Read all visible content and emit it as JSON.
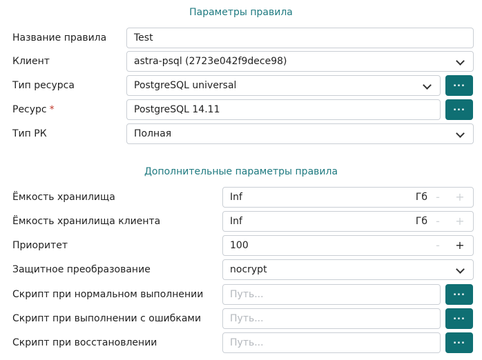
{
  "sections": {
    "main_title": "Параметры правила",
    "extra_title": "Дополнительные параметры правила"
  },
  "fields": {
    "rule_name": {
      "label": "Название правила",
      "value": "Test"
    },
    "client": {
      "label": "Клиент",
      "value": "astra-psql (2723e042f9dece98)"
    },
    "resource_type": {
      "label": "Тип ресурса",
      "value": "PostgreSQL universal",
      "button": "..."
    },
    "resource": {
      "label": "Ресурс",
      "required_mark": "*",
      "value": "PostgreSQL 14.11",
      "button": "..."
    },
    "backup_type": {
      "label": "Тип РК",
      "value": "Полная"
    },
    "storage_capacity": {
      "label": "Ёмкость хранилища",
      "value": "Inf",
      "unit": "Гб",
      "minus": "-",
      "plus": "+"
    },
    "client_storage_capacity": {
      "label": "Ёмкость хранилища клиента",
      "value": "Inf",
      "unit": "Гб",
      "minus": "-",
      "plus": "+"
    },
    "priority": {
      "label": "Приоритет",
      "value": "100",
      "minus": "-",
      "plus": "+"
    },
    "protective_transform": {
      "label": "Защитное преобразование",
      "value": "nocrypt"
    },
    "script_normal": {
      "label": "Скрипт при нормальном выполнении",
      "placeholder": "Путь...",
      "button": "..."
    },
    "script_errors": {
      "label": "Скрипт при выполнении с ошибками",
      "placeholder": "Путь...",
      "button": "..."
    },
    "script_restore": {
      "label": "Скрипт при восстановлении",
      "placeholder": "Путь...",
      "button": "..."
    }
  },
  "colors": {
    "accent": "#0f6f73",
    "section_title": "#1f7a80",
    "required": "#c0392b"
  }
}
